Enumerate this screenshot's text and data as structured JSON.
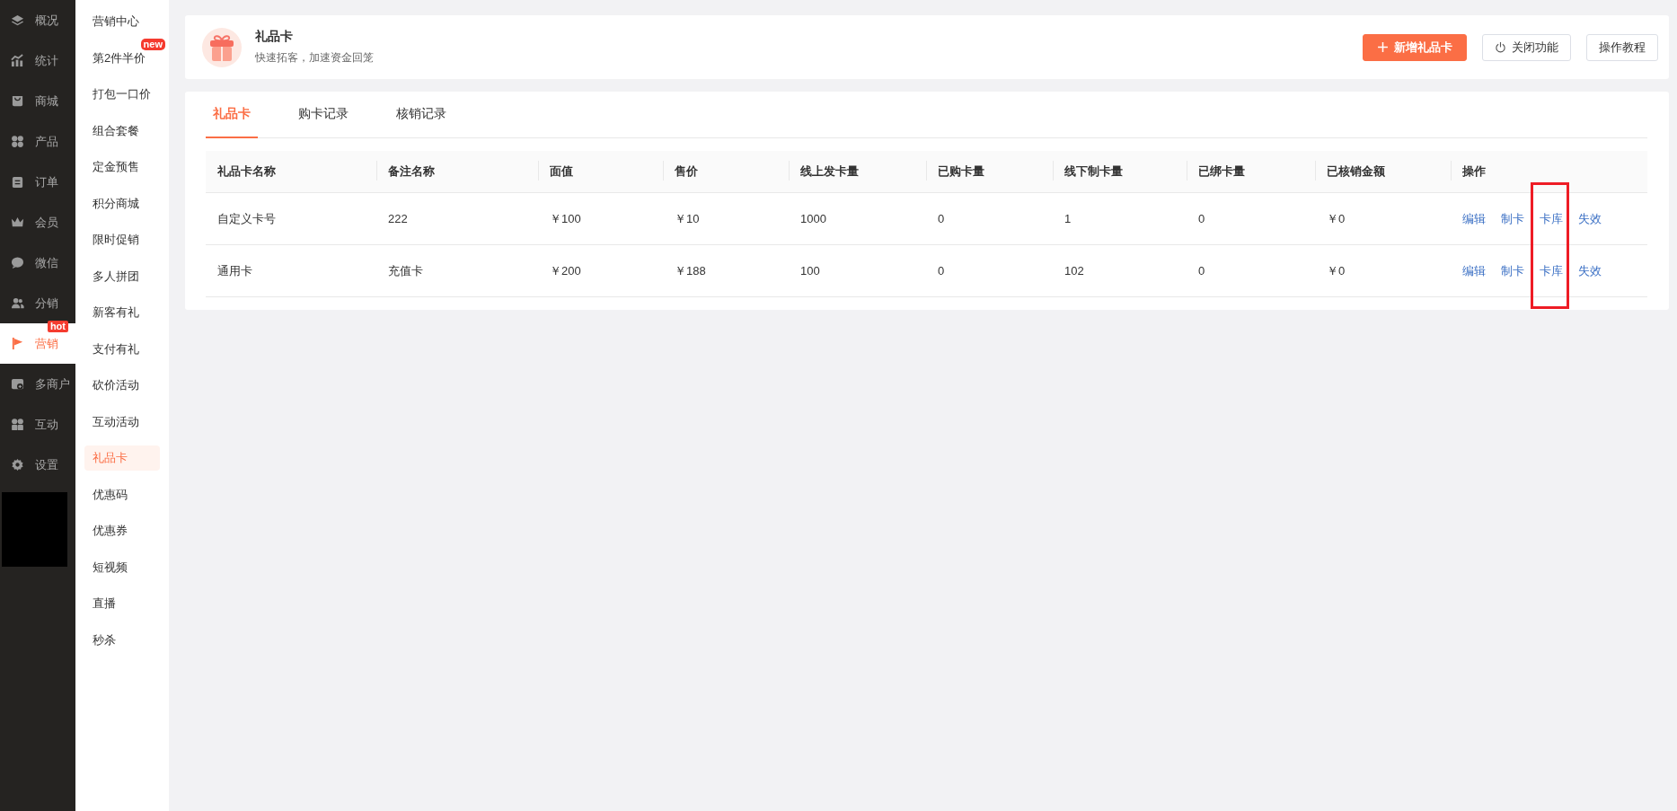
{
  "sidebar": {
    "items": [
      {
        "label": "概况",
        "selected": false
      },
      {
        "label": "统计",
        "selected": false
      },
      {
        "label": "商城",
        "selected": false
      },
      {
        "label": "产品",
        "selected": false
      },
      {
        "label": "订单",
        "selected": false
      },
      {
        "label": "会员",
        "selected": false
      },
      {
        "label": "微信",
        "selected": false
      },
      {
        "label": "分销",
        "selected": false
      },
      {
        "label": "营销",
        "selected": true,
        "badge": "hot"
      },
      {
        "label": "多商户",
        "selected": false
      },
      {
        "label": "互动",
        "selected": false
      },
      {
        "label": "设置",
        "selected": false
      }
    ]
  },
  "submenu": {
    "items": [
      {
        "label": "营销中心",
        "selected": false
      },
      {
        "label": "第2件半价",
        "selected": false,
        "badge": "new"
      },
      {
        "label": "打包一口价",
        "selected": false
      },
      {
        "label": "组合套餐",
        "selected": false
      },
      {
        "label": "定金预售",
        "selected": false
      },
      {
        "label": "积分商城",
        "selected": false
      },
      {
        "label": "限时促销",
        "selected": false
      },
      {
        "label": "多人拼团",
        "selected": false
      },
      {
        "label": "新客有礼",
        "selected": false
      },
      {
        "label": "支付有礼",
        "selected": false
      },
      {
        "label": "砍价活动",
        "selected": false
      },
      {
        "label": "互动活动",
        "selected": false
      },
      {
        "label": "礼品卡",
        "selected": true
      },
      {
        "label": "优惠码",
        "selected": false
      },
      {
        "label": "优惠券",
        "selected": false
      },
      {
        "label": "短视频",
        "selected": false
      },
      {
        "label": "直播",
        "selected": false
      },
      {
        "label": "秒杀",
        "selected": false
      }
    ]
  },
  "header": {
    "title": "礼品卡",
    "subtitle": "快速拓客，加速资金回笼",
    "buttons": [
      {
        "label": "新增礼品卡",
        "kind": "primary"
      },
      {
        "label": "关闭功能",
        "kind": "power"
      },
      {
        "label": "操作教程",
        "kind": "plain"
      }
    ]
  },
  "tabs": [
    {
      "label": "礼品卡",
      "selected": true
    },
    {
      "label": "购卡记录",
      "selected": false
    },
    {
      "label": "核销记录",
      "selected": false
    }
  ],
  "table": {
    "columns": [
      "礼品卡名称",
      "备注名称",
      "面值",
      "售价",
      "线上发卡量",
      "已购卡量",
      "线下制卡量",
      "已绑卡量",
      "已核销金额",
      "操作"
    ],
    "rows": [
      {
        "cells": [
          "自定义卡号",
          "222",
          "￥100",
          "￥10",
          "1000",
          "0",
          "1",
          "0",
          "￥0"
        ],
        "actions": [
          {
            "label": "编辑",
            "highlighted": false
          },
          {
            "label": "制卡",
            "highlighted": false
          },
          {
            "label": "卡库",
            "highlighted": true
          },
          {
            "label": "失效",
            "highlighted": false
          }
        ]
      },
      {
        "cells": [
          "通用卡",
          "充值卡",
          "￥200",
          "￥188",
          "100",
          "0",
          "102",
          "0",
          "￥0"
        ],
        "actions": [
          {
            "label": "编辑",
            "highlighted": false
          },
          {
            "label": "制卡",
            "highlighted": false
          },
          {
            "label": "卡库",
            "highlighted": true
          },
          {
            "label": "失效",
            "highlighted": false
          }
        ]
      }
    ]
  }
}
